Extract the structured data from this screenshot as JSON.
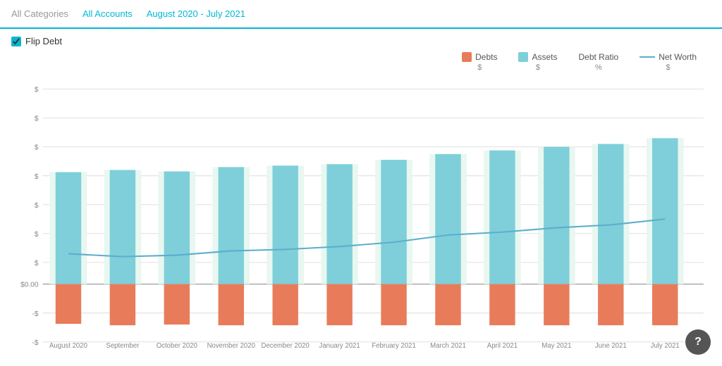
{
  "topbar": {
    "items": [
      {
        "label": "All Categories",
        "active": false
      },
      {
        "label": "All Accounts",
        "active": true
      },
      {
        "label": "August 2020 - July 2021",
        "active": true
      }
    ]
  },
  "flip_debt": {
    "label": "Flip Debt",
    "checked": true
  },
  "legend": {
    "debts": {
      "label": "Debts",
      "sub": "$"
    },
    "assets": {
      "label": "Assets",
      "sub": "$"
    },
    "debt_ratio": {
      "label": "Debt Ratio",
      "sub": "%"
    },
    "net_worth": {
      "label": "Net Worth",
      "sub": "$"
    }
  },
  "chart": {
    "months": [
      "August 2020",
      "September 2020",
      "October 2020",
      "November 2020",
      "December 2020",
      "January 2021",
      "February 2021",
      "March 2021",
      "April 2021",
      "May 2021",
      "June 2021",
      "July 2021"
    ],
    "y_labels": [
      "$",
      "$",
      "$",
      "$",
      "$",
      "$",
      "$",
      "$0.00",
      "-$",
      "-$"
    ],
    "zero_label": "$0.00"
  },
  "help_button": {
    "label": "?"
  }
}
